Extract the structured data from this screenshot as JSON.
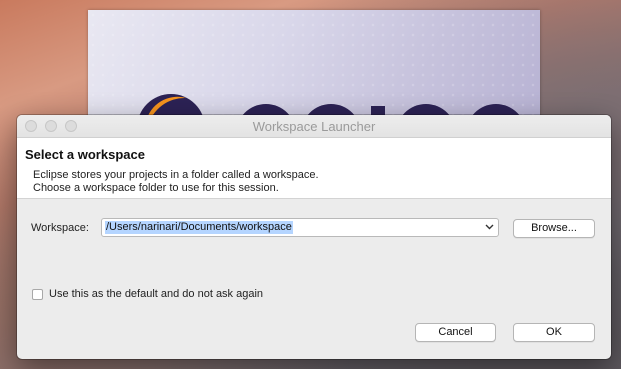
{
  "splash": {
    "logo_text": "eclipse"
  },
  "dialog": {
    "title": "Workspace Launcher",
    "header": {
      "heading": "Select a workspace",
      "line1": "Eclipse stores your projects in a folder called a workspace.",
      "line2": "Choose a workspace folder to use for this session."
    },
    "workspace": {
      "label": "Workspace:",
      "value": "/Users/narinari/Documents/workspace",
      "dropdown_icon": "chevron-down-icon",
      "browse_label": "Browse..."
    },
    "default_checkbox": {
      "label": "Use this as the default and do not ask again",
      "checked": false
    },
    "buttons": {
      "cancel": "Cancel",
      "ok": "OK"
    }
  },
  "colors": {
    "selection": "#b5d5ff",
    "eclipse_orange": "#f7941e",
    "eclipse_navy": "#2c2255"
  }
}
